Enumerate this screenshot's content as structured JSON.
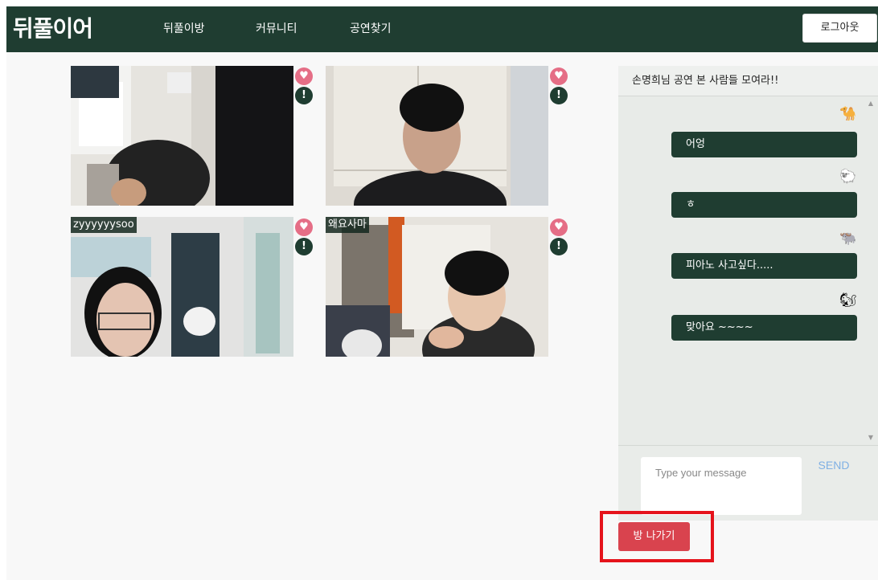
{
  "header": {
    "logo": "뒤풀이어",
    "nav": [
      "뒤풀이방",
      "커뮤니티",
      "공연찾기"
    ],
    "logout_label": "로그아웃"
  },
  "videos": [
    {
      "name": ""
    },
    {
      "name": ""
    },
    {
      "name": "zyyyyyysoo"
    },
    {
      "name": "왜요사마"
    }
  ],
  "tile_icons": {
    "like": "heart-icon",
    "report": "exclamation-icon"
  },
  "chat": {
    "title": "손명희님 공연 본 사람들 모여라!!",
    "messages": [
      {
        "avatar": "🐪",
        "avatar_icon": "camel-icon",
        "text": "어엉"
      },
      {
        "avatar": "🐑",
        "avatar_icon": "sheep-icon",
        "text": "ㅎ"
      },
      {
        "avatar": "🐃",
        "avatar_icon": "buffalo-icon",
        "text": "피아노 사고싶다....."
      },
      {
        "avatar": "🐿",
        "avatar_icon": "squirrel-icon",
        "text": "맞아요 ~~~~"
      }
    ],
    "input_placeholder": "Type your message",
    "send_label": "SEND"
  },
  "leave_label": "방 나가기",
  "colors": {
    "header_bg": "#1f3d31",
    "bubble_bg": "#1f3d31",
    "heart": "#e56e86",
    "leave_button": "#d9434e",
    "highlight": "#e5131b",
    "send_text": "#7fb0e4"
  }
}
